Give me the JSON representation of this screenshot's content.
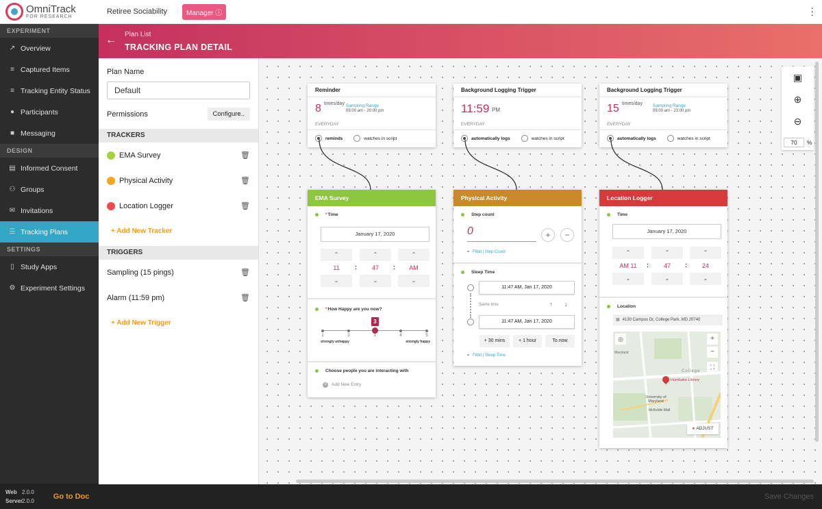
{
  "app": {
    "name": "OmniTrack",
    "sub": "FOR RESEARCH",
    "study": "Retiree Sociability",
    "role": "Manager ⓘ"
  },
  "sidebar": {
    "sections": [
      {
        "label": "EXPERIMENT",
        "items": [
          {
            "label": "Overview",
            "icon": "trend-icon"
          },
          {
            "label": "Captured Items",
            "icon": "list-icon"
          },
          {
            "label": "Tracking Entity Status",
            "icon": "list-icon"
          },
          {
            "label": "Participants",
            "icon": "person-icon"
          },
          {
            "label": "Messaging",
            "icon": "message-icon"
          }
        ]
      },
      {
        "label": "DESIGN",
        "items": [
          {
            "label": "Informed Consent",
            "icon": "document-icon"
          },
          {
            "label": "Groups",
            "icon": "group-icon"
          },
          {
            "label": "Invitations",
            "icon": "mail-icon"
          },
          {
            "label": "Tracking Plans",
            "icon": "sliders-icon"
          }
        ]
      },
      {
        "label": "SETTINGS",
        "items": [
          {
            "label": "Study Apps",
            "icon": "phone-icon"
          },
          {
            "label": "Experiment Settings",
            "icon": "gear-icon"
          }
        ]
      }
    ],
    "version": {
      "web_label": "Web",
      "web": "2.0.0",
      "server_label": "Server",
      "server": "2.0.0"
    },
    "doc_link": "Go to Doc"
  },
  "header": {
    "crumb": "Plan List",
    "title": "TRACKING PLAN DETAIL"
  },
  "panel": {
    "plan_name_label": "Plan Name",
    "plan_name": "Default",
    "permissions_label": "Permissions",
    "configure": "Configure..",
    "trackers_head": "TRACKERS",
    "trackers": [
      {
        "name": "EMA Survey",
        "color": "#a5d33f"
      },
      {
        "name": "Physical Activity",
        "color": "#f4a623"
      },
      {
        "name": "Location Logger",
        "color": "#ef4b4b"
      }
    ],
    "add_tracker": "+ Add New Tracker",
    "triggers_head": "TRIGGERS",
    "triggers": [
      {
        "name": "Sampling (15 pings)"
      },
      {
        "name": "Alarm (11:59 pm)"
      }
    ],
    "add_trigger": "+ Add New Trigger"
  },
  "zoom": {
    "value": "70",
    "unit": "%"
  },
  "save": "Save Changes",
  "trigger_cards": [
    {
      "title": "Reminder",
      "value": "8",
      "unit": "times/day",
      "range_label": "Sampling Range",
      "range": "09:00 am - 20:00 pm",
      "days": "EVERYDAY",
      "opt1": "reminds",
      "opt2": "watches in script"
    },
    {
      "title": "Background Logging Trigger",
      "value": "11:59",
      "unit": "PM",
      "days": "EVERYDAY",
      "opt1": "automatically logs",
      "opt2": "watches in script"
    },
    {
      "title": "Background Logging Trigger",
      "value": "15",
      "unit": "times/day",
      "range_label": "Sampling Range",
      "range": "09:00 am - 23:00 pm",
      "days": "EVERYDAY",
      "opt1": "automatically logs",
      "opt2": "watches in script"
    }
  ],
  "ema": {
    "title": "EMA Survey",
    "color": "#8dc63f",
    "time_label": "Time",
    "date": "January 17, 2020",
    "hour": "11",
    "minute": "47",
    "ampm": "AM",
    "q_label": "How Happy are you now?",
    "scale_value": "3",
    "scale": [
      "1",
      "2",
      "3",
      "4",
      "5"
    ],
    "low": "strongly unhappy",
    "high": "strongly happy",
    "people_label": "Choose people you are interacting with",
    "add_entry": "Add New Entry"
  },
  "pa": {
    "title": "Physical Activity",
    "color": "#c98a2c",
    "step_label": "Step count",
    "step_value": "0",
    "step_src": "Fitbit | Step Count",
    "sleep_label": "Sleep Time",
    "start": "11:47 AM, Jan 17, 2020",
    "same": "Same time",
    "end": "11:47 AM, Jan 17, 2020",
    "b1": "+ 30 mins",
    "b2": "+ 1 hour",
    "b3": "To now",
    "sleep_src": "Fitbit | Sleep Time"
  },
  "loc": {
    "title": "Location Logger",
    "color": "#d63a3a",
    "time_label": "Time",
    "date": "January 17, 2020",
    "hour": "AM 11",
    "minute": "47",
    "second": "24",
    "loc_label": "Location",
    "address": "4130 Campus Dr, College Park, MD 20740",
    "map_labels": {
      "campus": "University of Maryland",
      "pin": "Hornbake Library",
      "college": "College",
      "area": "Maryland",
      "lib": "McKeldin Mall",
      "adjust": "ADJUST"
    }
  }
}
